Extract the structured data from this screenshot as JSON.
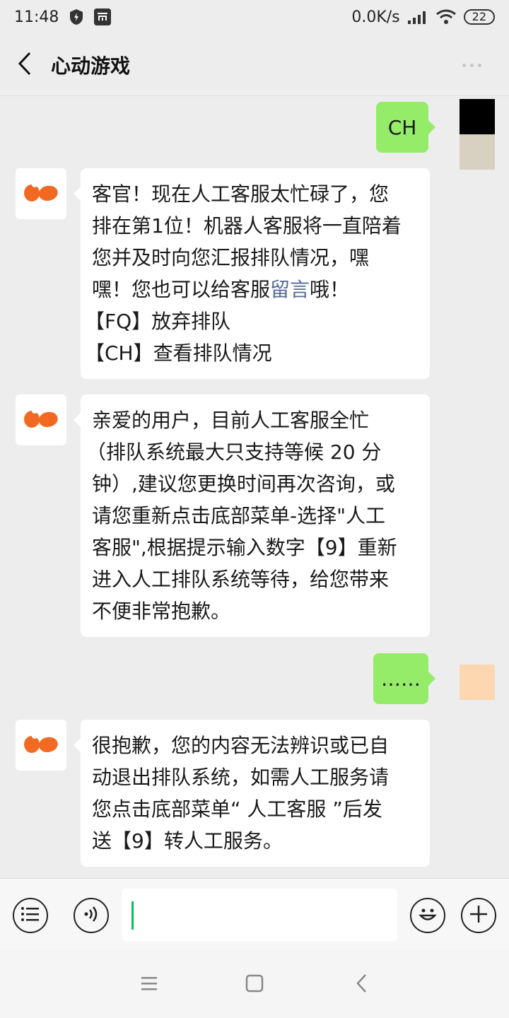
{
  "status_bar": {
    "time": "11:48",
    "speed": "0.0K/s",
    "battery": "22",
    "icons": [
      "shield-bolt-icon",
      "mi-icon",
      "signal-icon",
      "wifi-icon",
      "battery-icon"
    ]
  },
  "header": {
    "title": "心动游戏",
    "back_icon": "chevron-left-icon",
    "more_icon": "more-dots-icon"
  },
  "messages": [
    {
      "from": "user",
      "text": "CH"
    },
    {
      "from": "bot",
      "lines": [
        "客官！现在人工客服太忙碌了，您",
        "排在第1位！机器人客服将一直陪着",
        "您并及时向您汇报排队情况，嘿"
      ],
      "line4_pre": "嘿！您也可以给客服",
      "line4_link": "留言",
      "line4_post": "哦！",
      "line5": "【FQ】放弃排队",
      "line6": "【CH】查看排队情况"
    },
    {
      "from": "bot",
      "lines": [
        "亲爱的用户，目前人工客服全忙",
        "（排队系统最大只支持等候 20 分",
        "钟）,建议您更换时间再次咨询，或",
        "请您重新点击底部菜单-选择\"人工",
        "客服\",根据提示输入数字【9】重新",
        "进入人工排队系统等待，给您带来",
        "不便非常抱歉。"
      ]
    },
    {
      "from": "user",
      "text": "……"
    },
    {
      "from": "bot",
      "lines": [
        "很抱歉，您的内容无法辨识或已自",
        "动退出排队系统，如需人工服务请",
        "您点击底部菜单“ 人工客服 ”后发",
        "送【9】转人工服务。"
      ]
    }
  ],
  "input_bar": {
    "menu_icon": "menu-list-icon",
    "voice_icon": "voice-icon",
    "input_value": "",
    "emoji_icon": "emoji-icon",
    "plus_icon": "plus-icon"
  },
  "colors": {
    "user_bubble": "#95ec69",
    "bot_bubble": "#ffffff",
    "background": "#ededed",
    "link": "#576b95",
    "brand_orange": "#f26a21"
  }
}
